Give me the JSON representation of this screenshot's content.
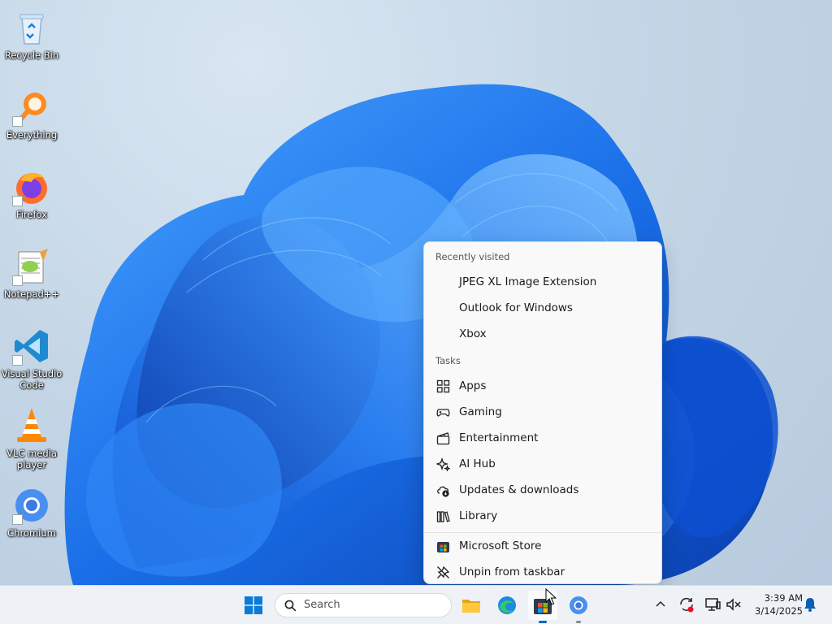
{
  "desktop": {
    "icons": [
      {
        "label": "Recycle Bin",
        "icon": "recycle-bin-icon"
      },
      {
        "label": "Everything",
        "icon": "everything-search-icon"
      },
      {
        "label": "Firefox",
        "icon": "firefox-icon"
      },
      {
        "label": "Notepad++",
        "icon": "notepadpp-icon"
      },
      {
        "label": "Visual Studio Code",
        "icon": "vscode-icon"
      },
      {
        "label": "VLC media player",
        "icon": "vlc-icon"
      },
      {
        "label": "Chromium",
        "icon": "chromium-icon"
      }
    ]
  },
  "jumplist": {
    "recent_header": "Recently visited",
    "recent": [
      {
        "label": "JPEG XL Image Extension"
      },
      {
        "label": "Outlook for Windows"
      },
      {
        "label": "Xbox"
      }
    ],
    "tasks_header": "Tasks",
    "tasks": [
      {
        "label": "Apps",
        "icon": "apps-grid-icon"
      },
      {
        "label": "Gaming",
        "icon": "gamepad-icon"
      },
      {
        "label": "Entertainment",
        "icon": "clapperboard-icon"
      },
      {
        "label": "AI Hub",
        "icon": "sparkle-icon"
      },
      {
        "label": "Updates & downloads",
        "icon": "cloud-download-icon"
      },
      {
        "label": "Library",
        "icon": "library-books-icon"
      }
    ],
    "pinned": [
      {
        "label": "Microsoft Store",
        "icon": "microsoft-store-icon"
      },
      {
        "label": "Unpin from taskbar",
        "icon": "unpin-icon"
      }
    ]
  },
  "taskbar": {
    "search_placeholder": "Search",
    "apps": [
      "start-icon",
      "file-explorer-icon",
      "edge-icon",
      "microsoft-store-icon",
      "chromium-icon"
    ],
    "clock": {
      "time": "3:39 AM",
      "date": "3/14/2025"
    }
  },
  "colors": {
    "accent": "#0067c0",
    "wallpaper_bloom": "#1a6fe8"
  }
}
